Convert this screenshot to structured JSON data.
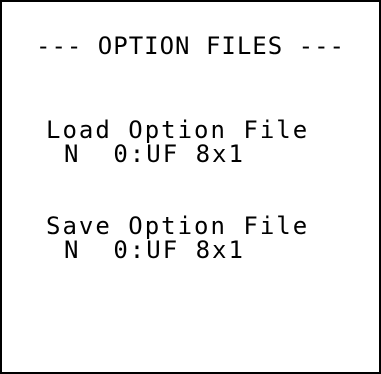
{
  "screen": {
    "title": "--- OPTION FILES ---",
    "load": {
      "label": "Load Option File",
      "value": "N  0:UF 8x1"
    },
    "save": {
      "label": "Save Option File",
      "value": "N  0:UF 8x1"
    }
  }
}
